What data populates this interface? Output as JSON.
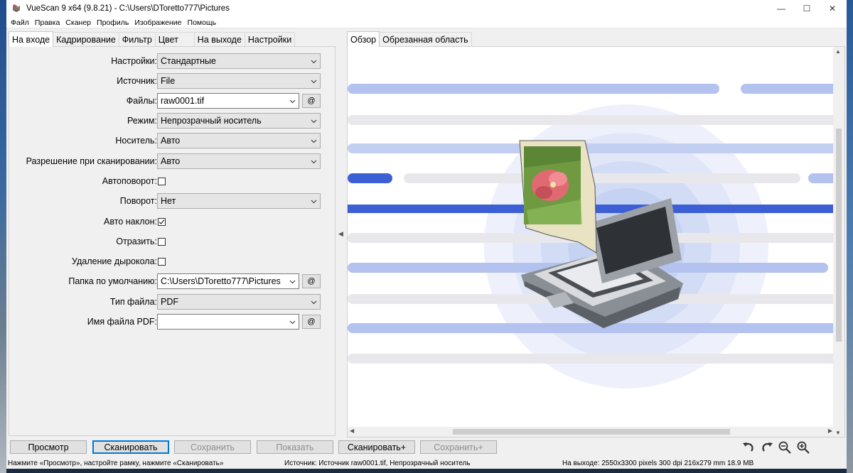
{
  "window": {
    "title": "VueScan 9 x64 (9.8.21) - C:\\Users\\DToretto777\\Pictures",
    "minimize": "—",
    "maximize": "☐",
    "close": "✕"
  },
  "menu": [
    "Файл",
    "Правка",
    "Сканер",
    "Профиль",
    "Изображение",
    "Помощь"
  ],
  "left_tabs": [
    "На входе",
    "Кадрирование",
    "Фильтр",
    "Цвет",
    "На выходе",
    "Настройки"
  ],
  "right_tabs": [
    "Обзор",
    "Обрезанная область"
  ],
  "form": {
    "settings": {
      "label": "Настройки:",
      "value": "Стандартные"
    },
    "source": {
      "label": "Источник:",
      "value": "File"
    },
    "files": {
      "label": "Файлы:",
      "value": "raw0001.tif",
      "button": "@"
    },
    "mode": {
      "label": "Режим:",
      "value": "Непрозрачный носитель"
    },
    "media": {
      "label": "Носитель:",
      "value": "Авто"
    },
    "resolution": {
      "label": "Разрешение при сканировании:",
      "value": "Авто"
    },
    "autorotate": {
      "label": "Автоповорот:",
      "checked": false
    },
    "rotation": {
      "label": "Поворот:",
      "value": "Нет"
    },
    "auto_deskew": {
      "label": "Авто наклон:",
      "checked": true
    },
    "mirror": {
      "label": "Отразить:",
      "checked": false
    },
    "hole_removal": {
      "label": "Удаление дырокола:",
      "checked": false
    },
    "default_folder": {
      "label": "Папка по умолчанию:",
      "value": "C:\\Users\\DToretto777\\Pictures",
      "button": "@"
    },
    "file_type": {
      "label": "Тип файла:",
      "value": "PDF"
    },
    "pdf_name": {
      "label": "Имя файла PDF:",
      "value": "",
      "button": "@"
    }
  },
  "buttons": {
    "preview": "Просмотр",
    "scan": "Сканировать",
    "save": "Сохранить",
    "show": "Показать",
    "scan_plus": "Сканировать+",
    "save_plus": "Сохранить+"
  },
  "status": {
    "hint": "Нажмите «Просмотр», настройте рамку, нажмите «Сканировать»",
    "source": "Источник: Источник raw0001.tif, Непрозрачный носитель",
    "output": "На выходе: 2550x3300 pixels 300 dpi 216x279 mm 18.9 MB"
  },
  "colors": {
    "accent": "#0078d7",
    "stripe_light": "#b3c2ee",
    "stripe_dark": "#3d5fd6",
    "circle": "#dde4f7"
  }
}
